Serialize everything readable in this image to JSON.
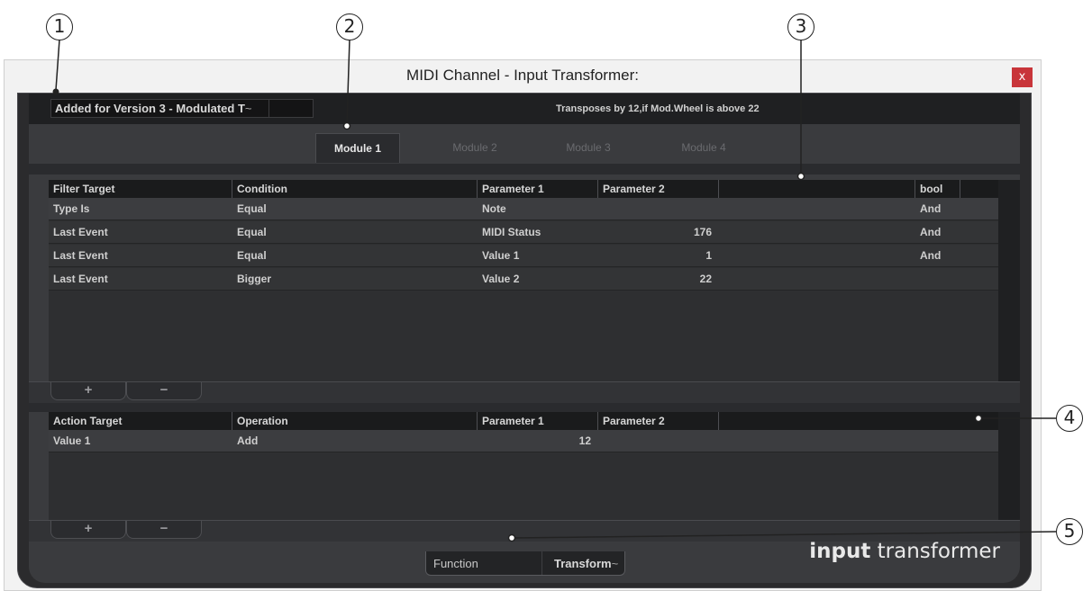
{
  "callouts": [
    "1",
    "2",
    "3",
    "4",
    "5"
  ],
  "window": {
    "title": "MIDI Channel - Input Transformer:",
    "close_label": "x"
  },
  "preset": {
    "name": "Added for Version 3 - Modulated T",
    "arrow": "~",
    "description": "Transposes by 12,if Mod.Wheel is above 22"
  },
  "tabs": [
    {
      "label": "Module 1",
      "active": true
    },
    {
      "label": "Module 2",
      "active": false
    },
    {
      "label": "Module 3",
      "active": false
    },
    {
      "label": "Module 4",
      "active": false
    }
  ],
  "filter": {
    "headers": [
      "Filter Target",
      "Condition",
      "Parameter 1",
      "Parameter 2",
      "",
      "bool"
    ],
    "rows": [
      [
        "Type Is",
        "Equal",
        "Note",
        "",
        "And"
      ],
      [
        "Last Event",
        "Equal",
        "MIDI Status",
        "176",
        "And"
      ],
      [
        "Last Event",
        "Equal",
        "Value 1",
        "1",
        "And"
      ],
      [
        "Last Event",
        "Bigger",
        "Value 2",
        "22",
        ""
      ]
    ]
  },
  "action": {
    "headers": [
      "Action Target",
      "Operation",
      "Parameter 1",
      "Parameter 2",
      ""
    ],
    "rows": [
      [
        "Value 1",
        "Add",
        "12",
        ""
      ]
    ]
  },
  "buttons": {
    "add": "+",
    "remove": "−"
  },
  "function": {
    "label": "Function",
    "value": "Transform",
    "arrow": "~"
  },
  "brand": {
    "bold": "input",
    "rest": " transformer"
  }
}
